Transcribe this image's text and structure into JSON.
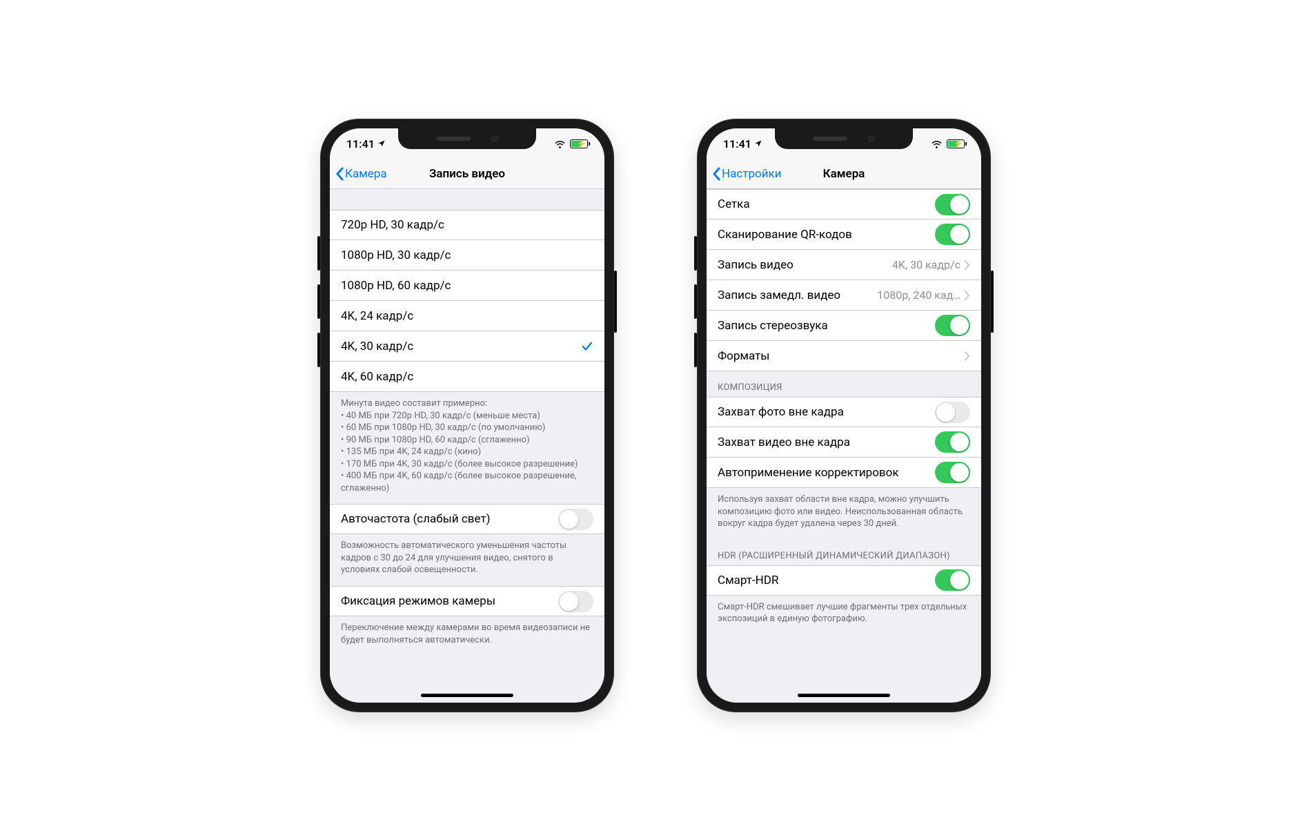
{
  "status": {
    "time": "11:41"
  },
  "phone1": {
    "back": "Камера",
    "title": "Запись видео",
    "options": [
      "720p HD, 30 кадр/с",
      "1080p HD, 30 кадр/с",
      "1080p HD, 60 кадр/с",
      "4K, 24 кадр/с",
      "4K, 30 кадр/с",
      "4K, 60 кадр/с"
    ],
    "selected_index": 4,
    "size_footer_title": "Минута видео составит примерно:",
    "size_lines": [
      "• 40 МБ при 720p HD, 30 кадр/с (меньше места)",
      "• 60 МБ при 1080p HD, 30 кадр/с (по умолчанию)",
      "• 90 МБ при 1080p HD, 60 кадр/с (сглаженно)",
      "• 135 МБ при 4K, 24 кадр/с (кино)",
      "• 170 МБ при 4K, 30 кадр/с (более высокое разрешение)",
      "• 400 МБ при 4K, 60 кадр/с (более высокое разрешение, сглаженно)"
    ],
    "auto_fps_label": "Авточастота (слабый свет)",
    "auto_fps_on": false,
    "auto_fps_footer": "Возможность автоматического уменьшения частоты кадров с 30 до 24 для улучшения видео, снятого в условиях слабой освещенности.",
    "lock_label": "Фиксация режимов камеры",
    "lock_on": false,
    "lock_footer": "Переключение между камерами во время видеозаписи не будет выполняться автоматически."
  },
  "phone2": {
    "back": "Настройки",
    "title": "Камера",
    "rows": {
      "grid": {
        "label": "Сетка",
        "on": true
      },
      "qr": {
        "label": "Сканирование QR-кодов",
        "on": true
      },
      "video": {
        "label": "Запись видео",
        "detail": "4K, 30 кадр/с"
      },
      "slomo": {
        "label": "Запись замедл. видео",
        "detail": "1080p, 240 кад…"
      },
      "stereo": {
        "label": "Запись стереозвука",
        "on": true
      },
      "formats": {
        "label": "Форматы"
      }
    },
    "composition_header": "КОМПОЗИЦИЯ",
    "comp": {
      "photo_outside": {
        "label": "Захват фото вне кадра",
        "on": false
      },
      "video_outside": {
        "label": "Захват видео вне кадра",
        "on": true
      },
      "auto_apply": {
        "label": "Автоприменение корректировок",
        "on": true
      }
    },
    "comp_footer": "Используя захват области вне кадра, можно улучшить композицию фото или видео. Неиспользованная область вокруг кадра будет удалена через 30 дней.",
    "hdr_header": "HDR (РАСШИРЕННЫЙ ДИНАМИЧЕСКИЙ ДИАПАЗОН)",
    "hdr": {
      "label": "Смарт-HDR",
      "on": true
    },
    "hdr_footer": "Смарт-HDR смешивает лучшие фрагменты трех отдельных экспозиций в единую фотографию."
  }
}
